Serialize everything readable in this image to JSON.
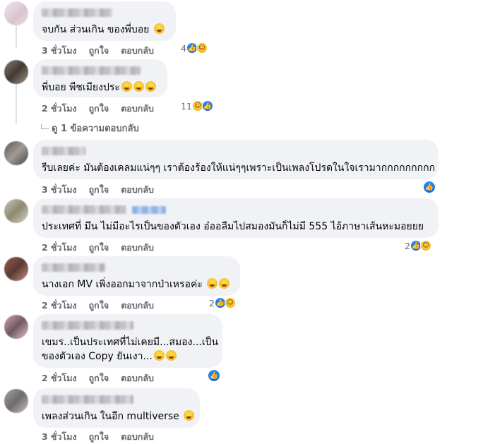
{
  "comments": [
    {
      "text": "จบกัน ส่วนเกิน ของพี่บอย",
      "time": "3 ชั่วโมง",
      "like": "ถูกใจ",
      "reply": "ตอบกลับ",
      "reactions": "4"
    },
    {
      "text": "พี่บอย พีชเมียงประ",
      "time": "2 ชั่วโมง",
      "like": "ถูกใจ",
      "reply": "ตอบกลับ",
      "reactions": "11"
    },
    {
      "text": "รีบเลยค่ะ มันต้องเคลมแน่ๆๆ เราต้องร้องให้แน่ๆๆเพราะเป็นเพลงโปรดในใจเรามากกกกกกกกก",
      "time": "3 ชั่วโมง",
      "like": "ถูกใจ",
      "reply": "ตอบกลับ",
      "reactions": ""
    },
    {
      "text": "ประเทศที่ มึน ไม่มีอะไรเป็นของตัวเอง อ๋ออลืมไปสมองมันก็ไม่มี 555 ไอ้ภาษาเส้นหะมอยยย",
      "time": "2 ชั่วโมง",
      "like": "ถูกใจ",
      "reply": "ตอบกลับ",
      "reactions": "2"
    },
    {
      "text": "นางเอก MV เพิ่งออกมาจากป่าเหรอค่ะ",
      "time": "2 ชั่วโมง",
      "like": "ถูกใจ",
      "reply": "ตอบกลับ",
      "reactions": "2"
    },
    {
      "text_line1": "เขมร..เป็นประเทศที่ไม่เคยมี...สมอง...เป็น",
      "text_line2": "ของตัวเอง Copy ยันเงา...",
      "time": "2 ชั่วโมง",
      "like": "ถูกใจ",
      "reply": "ตอบกลับ",
      "reactions": ""
    },
    {
      "text": "เพลงส่วนเกิน ในอีก multiverse",
      "time": "3 ชั่วโมง",
      "like": "ถูกใจ",
      "reply": "ตอบกลับ",
      "reactions": ""
    }
  ],
  "view_replies": "ดู 1 ข้อความตอบกลับ",
  "icons": {
    "like": "like-icon",
    "haha": "haha-icon",
    "reply_arrow": "reply-arrow-icon"
  },
  "colors": {
    "bubble": "#f0f2f5",
    "meta": "#65676b",
    "like_blue": "#0866ff"
  }
}
